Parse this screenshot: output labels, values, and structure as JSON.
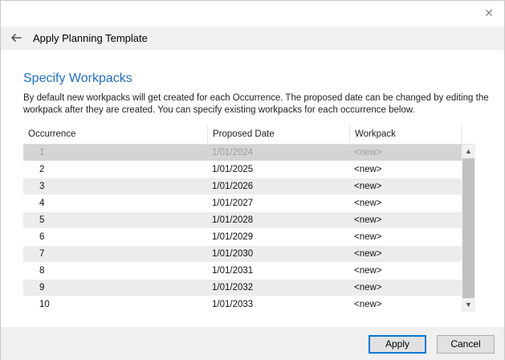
{
  "window": {
    "close_label": "✕"
  },
  "header": {
    "title": "Apply Planning Template",
    "back_icon": "back-arrow-icon"
  },
  "content": {
    "section_title": "Specify Workpacks",
    "description": "By default new workpacks will get created for each Occurrence. The proposed date can be changed by editing the workpack after they are created. You can specify existing workpacks for each occurrence below."
  },
  "grid": {
    "columns": [
      "Occurrence",
      "Proposed Date",
      "Workpack"
    ],
    "rows": [
      {
        "occurrence": "1",
        "date": "1/01/2024",
        "workpack": "<new>"
      },
      {
        "occurrence": "2",
        "date": "1/01/2025",
        "workpack": "<new>"
      },
      {
        "occurrence": "3",
        "date": "1/01/2026",
        "workpack": "<new>"
      },
      {
        "occurrence": "4",
        "date": "1/01/2027",
        "workpack": "<new>"
      },
      {
        "occurrence": "5",
        "date": "1/01/2028",
        "workpack": "<new>"
      },
      {
        "occurrence": "6",
        "date": "1/01/2029",
        "workpack": "<new>"
      },
      {
        "occurrence": "7",
        "date": "1/01/2030",
        "workpack": "<new>"
      },
      {
        "occurrence": "8",
        "date": "1/01/2031",
        "workpack": "<new>"
      },
      {
        "occurrence": "9",
        "date": "1/01/2032",
        "workpack": "<new>"
      },
      {
        "occurrence": "10",
        "date": "1/01/2033",
        "workpack": "<new>"
      }
    ],
    "selected_index": 0,
    "scroll_up_glyph": "▲",
    "scroll_down_glyph": "▼"
  },
  "footer": {
    "apply_label": "Apply",
    "cancel_label": "Cancel"
  },
  "colors": {
    "accent": "#1f6fc4",
    "primary_button_border": "#0078d7"
  }
}
